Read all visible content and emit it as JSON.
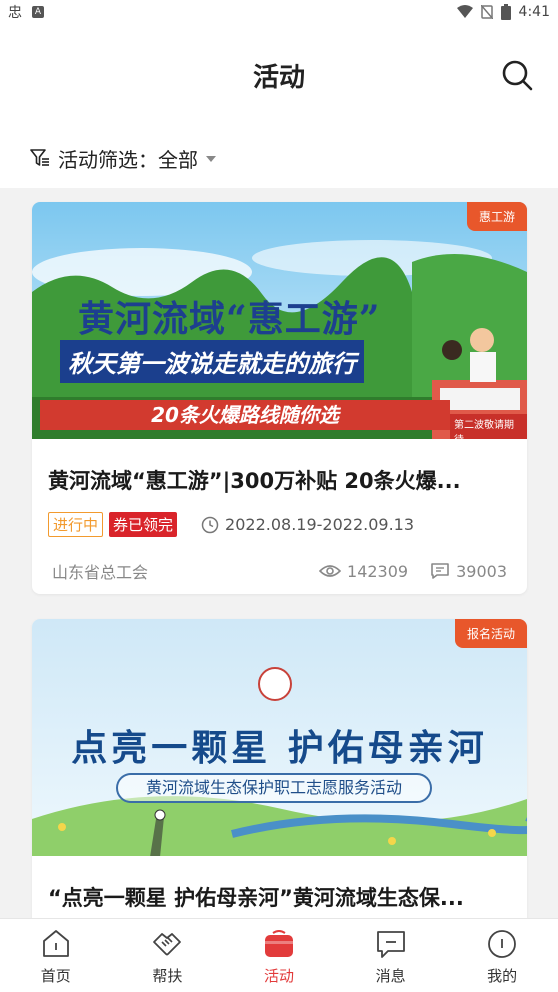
{
  "status_bar": {
    "time": "4:41",
    "app_glyph": "忠",
    "a_icon": "A"
  },
  "header": {
    "title": "活动"
  },
  "filter": {
    "label": "活动筛选：",
    "value": "全部"
  },
  "cards": [
    {
      "tag": "惠工游",
      "banner_headline": "黄河流域“惠工游”",
      "banner_sub": "秋天第一波说走就走的旅行",
      "banner_route": "20条火爆路线随你选",
      "banner_small": "第二波敬请期待",
      "title": "黄河流域“惠工游”|300万补贴 20条火爆...",
      "status": "进行中",
      "coupon": "券已领完",
      "date_range": "2022.08.19-2022.09.13",
      "org": "山东省总工会",
      "views": "142309",
      "comments": "39003"
    },
    {
      "tag": "报名活动",
      "banner_headline": "点亮一颗星 护佑母亲河",
      "banner_pill": "黄河流域生态保护职工志愿服务活动",
      "title": "“点亮一颗星 护佑母亲河”黄河流域生态保..."
    }
  ],
  "nav": [
    {
      "label": "首页",
      "icon": "home-icon",
      "active": false
    },
    {
      "label": "帮扶",
      "icon": "handshake-icon",
      "active": false
    },
    {
      "label": "活动",
      "icon": "gift-bag-icon",
      "active": true
    },
    {
      "label": "消息",
      "icon": "message-icon",
      "active": false
    },
    {
      "label": "我的",
      "icon": "profile-icon",
      "active": false
    }
  ],
  "colors": {
    "accent": "#e23b3b",
    "tag": "#e8572b",
    "ongoing": "#f29a2e",
    "coupon": "#d9242a"
  }
}
